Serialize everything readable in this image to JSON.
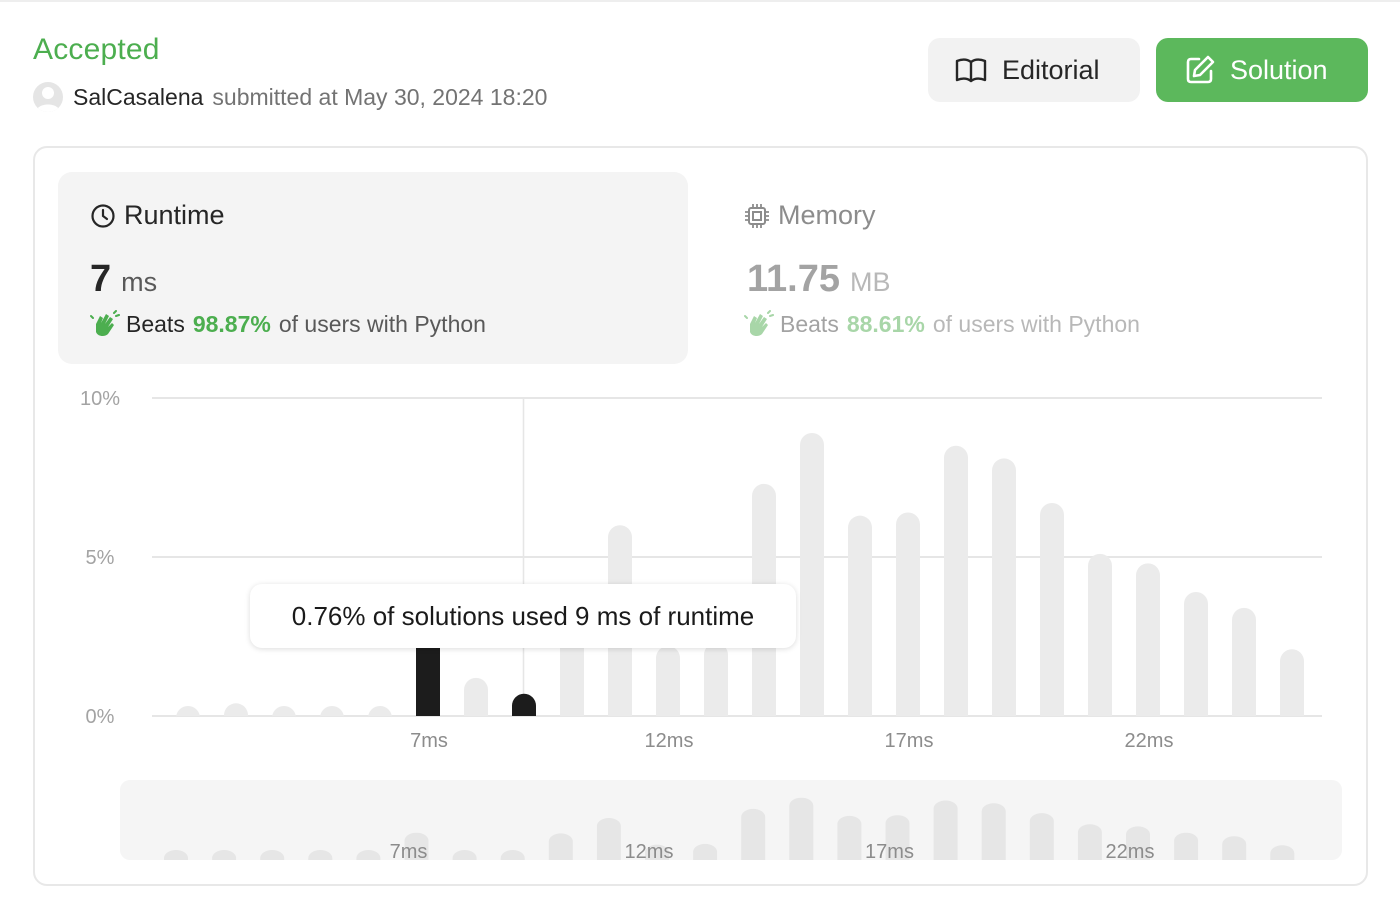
{
  "submission": {
    "status": "Accepted",
    "username": "SalCasalena",
    "submitted_text": "submitted at May 30, 2024 18:20"
  },
  "buttons": {
    "editorial": "Editorial",
    "solution": "Solution"
  },
  "runtime": {
    "title": "Runtime",
    "value": "7",
    "unit": "ms",
    "beats_label": "Beats",
    "beats_pct": "98.87%",
    "beats_rest": "of users with Python"
  },
  "memory": {
    "title": "Memory",
    "value": "11.75",
    "unit": "MB",
    "beats_label": "Beats",
    "beats_pct": "88.61%",
    "beats_rest": "of users with Python"
  },
  "tooltip": "0.76% of solutions used 9 ms of runtime",
  "colors": {
    "accent_green": "#4cae4f",
    "button_green": "#5cb85c",
    "bar_default": "#ebebeb",
    "bar_highlight": "#1c1c1c"
  },
  "chart_data": {
    "type": "bar",
    "ylabel": "",
    "xlabel": "",
    "ylim": [
      0,
      10
    ],
    "y_ticks": [
      "0%",
      "5%",
      "10%"
    ],
    "x_ticks": [
      "7ms",
      "12ms",
      "17ms",
      "22ms"
    ],
    "x": [
      2,
      3,
      4,
      5,
      6,
      7,
      8,
      9,
      10,
      11,
      12,
      13,
      14,
      15,
      16,
      17,
      18,
      19,
      20,
      21,
      22,
      23,
      24,
      25,
      26
    ],
    "values": [
      0.3,
      0.4,
      0.3,
      0.3,
      0.3,
      3.9,
      1.2,
      0.7,
      3.8,
      6.0,
      2.2,
      2.3,
      7.3,
      8.9,
      6.3,
      6.4,
      8.5,
      8.1,
      6.7,
      5.1,
      4.8,
      3.9,
      3.4,
      2.1
    ],
    "highlighted_x": [
      7,
      9
    ],
    "current_x": 7
  }
}
